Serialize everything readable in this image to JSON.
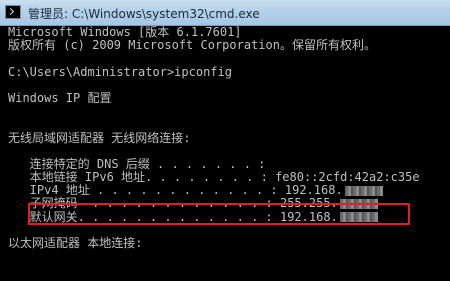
{
  "window": {
    "title": "管理员: C:\\Windows\\system32\\cmd.exe",
    "icon": "cmd-icon"
  },
  "console": {
    "line1": "Microsoft Windows [版本 6.1.7601]",
    "line2": "版权所有 (c) 2009 Microsoft Corporation。保留所有权利。",
    "prompt": "C:\\Users\\Administrator>ipconfig",
    "header": "Windows IP 配置",
    "wireless_header": "无线局域网适配器 无线网络连接:",
    "dns_suffix": "   连接特定的 DNS 后缀 . . . . . . . :",
    "ipv6": "   本地链接 IPv6 地址. . . . . . . . : fe80::2cfd:42a2:c35e",
    "ipv4_label": "   IPv4 地址 . . . . . . . . . . . . : ",
    "ipv4_value": "192.168.",
    "mask_label": "   子网掩码  . . . . . . . . . . . . : ",
    "mask_value": "255.255.",
    "gateway_label": "   默认网关. . . . . . . . . . . . . : ",
    "gateway_value": "192.168.",
    "ethernet_header": "以太网适配器 本地连接:"
  },
  "colors": {
    "console_bg": "#000000",
    "console_text": "#c0c0c0",
    "highlight_border": "#e02020"
  }
}
